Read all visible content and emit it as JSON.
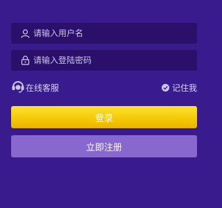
{
  "form": {
    "username": {
      "placeholder": "请输入用户名",
      "value": "",
      "icon": "user-icon"
    },
    "password": {
      "placeholder": "请输入登陆密码",
      "value": "",
      "icon": "lock-icon"
    },
    "online_service": {
      "label": "在线客服",
      "icon": "headset-icon"
    },
    "remember_me": {
      "label": "记住我",
      "icon": "check-circle-icon",
      "checked": true
    },
    "login_label": "登录",
    "register_label": "立即注册"
  },
  "colors": {
    "background": "#3a1b8d",
    "field": "#2b0f6b",
    "login_button": "#f5c800",
    "register_button": "#8867cf",
    "text_light": "#d8d0ff"
  }
}
